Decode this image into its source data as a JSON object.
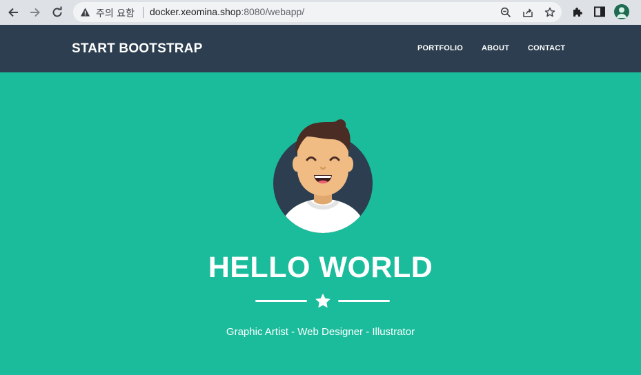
{
  "browser": {
    "back_icon": "arrow-left-icon",
    "forward_icon": "arrow-right-icon",
    "reload_icon": "reload-icon",
    "security_warning": "주의 요함",
    "url_host": "docker.xeomina.shop",
    "url_rest": ":8080/webapp/",
    "zoom_icon": "zoom-icon",
    "share_icon": "share-icon",
    "bookmark_icon": "star-icon",
    "extensions_icon": "puzzle-icon",
    "side_panel_icon": "side-panel-icon",
    "profile_icon": "profile-avatar-icon"
  },
  "navbar": {
    "brand": "START BOOTSTRAP",
    "links": [
      "PORTFOLIO",
      "ABOUT",
      "CONTACT"
    ],
    "background": "#2c3e50"
  },
  "masthead": {
    "avatar_icon": "smiling-man-avatar",
    "title": "HELLO WORLD",
    "divider_icon": "star-icon",
    "subtitle": "Graphic Artist - Web Designer - Illustrator",
    "background": "#1abc9c"
  }
}
